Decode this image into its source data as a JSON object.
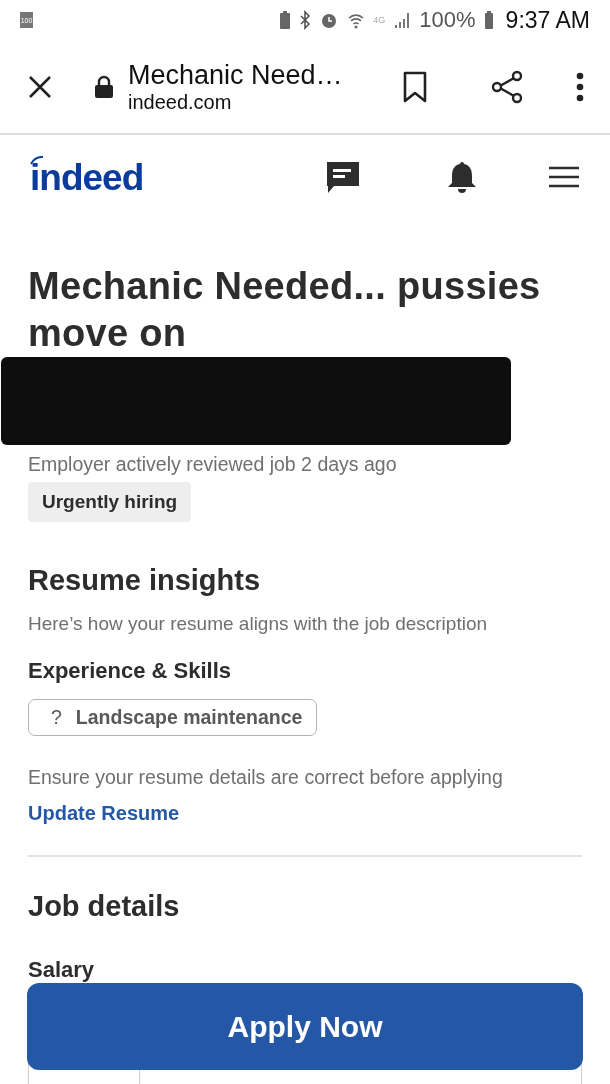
{
  "status_bar": {
    "battery_badge": "100",
    "network": "4G",
    "battery_percent": "100%",
    "time": "9:37 AM"
  },
  "browser": {
    "title": "Mechanic Need…",
    "url": "indeed.com"
  },
  "site_header": {
    "logo": "indeed"
  },
  "job": {
    "title": "Mechanic Needed... pussies move on",
    "redacted": true,
    "activity": "Employer actively reviewed job 2 days ago",
    "badges": [
      "Urgently hiring"
    ]
  },
  "resume_insights": {
    "heading": "Resume insights",
    "subtitle": "Here’s how your resume aligns with the job description",
    "skills_heading": "Experience & Skills",
    "skills": [
      {
        "icon": "?",
        "label": "Landscape maintenance"
      }
    ],
    "note": "Ensure your resume details are correct before applying",
    "link": "Update Resume"
  },
  "job_details": {
    "heading": "Job details",
    "salary_label": "Salary"
  },
  "apply_button": "Apply Now"
}
